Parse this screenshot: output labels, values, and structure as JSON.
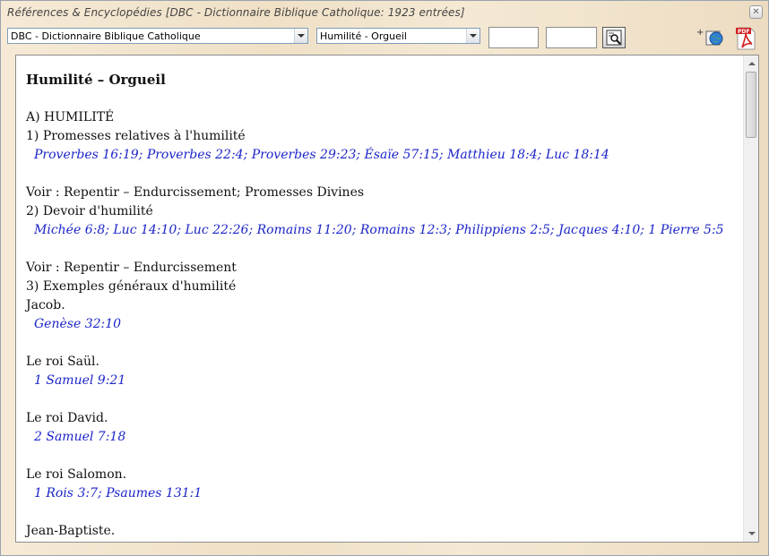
{
  "window": {
    "title": "Références & Encyclopédies [DBC - Dictionnaire Biblique Catholique:  1923 entrées]",
    "close_glyph": "✕"
  },
  "toolbar": {
    "dictionary_select": "DBC - Dictionnaire Biblique Catholique",
    "entry_select": "Humilité - Orgueil",
    "search_box_1": "",
    "search_box_2": "",
    "icons": {
      "search": "search-icon",
      "add_web": "add-web-icon",
      "pdf": "pdf-icon"
    },
    "add_plus": "+",
    "pdf_label": "PDF"
  },
  "content": {
    "heading": "Humilité – Orgueil",
    "lines": [
      {
        "type": "text",
        "text": "A) HUMILITÉ"
      },
      {
        "type": "text",
        "text": "1) Promesses relatives à l'humilité"
      },
      {
        "type": "ref",
        "text": "Proverbes 16:19; Proverbes 22:4; Proverbes 29:23; Ésaïe 57:15; Matthieu 18:4; Luc 18:14"
      },
      {
        "type": "gap",
        "text": ""
      },
      {
        "type": "text",
        "text": "Voir : Repentir – Endurcissement; Promesses Divines"
      },
      {
        "type": "text",
        "text": "2) Devoir d'humilité"
      },
      {
        "type": "ref",
        "text": "Michée 6:8; Luc 14:10; Luc 22:26; Romains 11:20; Romains 12:3; Philippiens 2:5; Jacques 4:10; 1 Pierre 5:5"
      },
      {
        "type": "gap",
        "text": ""
      },
      {
        "type": "text",
        "text": "Voir : Repentir – Endurcissement"
      },
      {
        "type": "text",
        "text": "3) Exemples généraux d'humilité"
      },
      {
        "type": "text",
        "text": "Jacob."
      },
      {
        "type": "ref",
        "text": "Genèse 32:10"
      },
      {
        "type": "gap",
        "text": ""
      },
      {
        "type": "text",
        "text": "Le roi Saül."
      },
      {
        "type": "ref",
        "text": "1 Samuel 9:21"
      },
      {
        "type": "gap",
        "text": ""
      },
      {
        "type": "text",
        "text": "Le roi David."
      },
      {
        "type": "ref",
        "text": "2 Samuel 7:18"
      },
      {
        "type": "gap",
        "text": ""
      },
      {
        "type": "text",
        "text": "Le roi Salomon."
      },
      {
        "type": "ref",
        "text": "1 Rois 3:7; Psaumes 131:1"
      },
      {
        "type": "gap",
        "text": ""
      },
      {
        "type": "text",
        "text": "Jean-Baptiste."
      }
    ]
  },
  "colors": {
    "reference_link": "#1c25c8",
    "body_text": "#111111",
    "window_bg": "#f3e6cf"
  }
}
